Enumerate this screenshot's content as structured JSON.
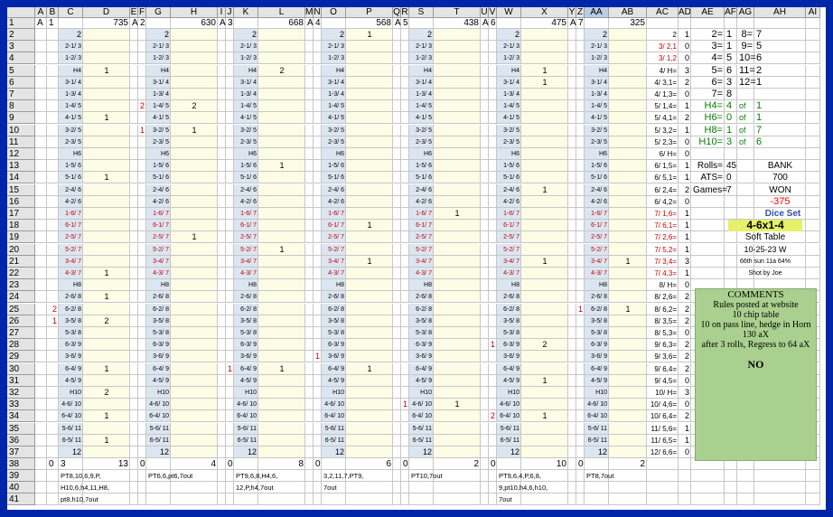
{
  "cols": [
    {
      "c": "A",
      "w": 13
    },
    {
      "c": "B",
      "w": 13
    },
    {
      "c": "C",
      "w": 27
    },
    {
      "c": "D",
      "w": 52
    },
    {
      "c": "E",
      "w": 9
    },
    {
      "c": "F",
      "w": 9
    },
    {
      "c": "G",
      "w": 27
    },
    {
      "c": "H",
      "w": 52
    },
    {
      "c": "I",
      "w": 9
    },
    {
      "c": "J",
      "w": 9
    },
    {
      "c": "K",
      "w": 27
    },
    {
      "c": "L",
      "w": 52
    },
    {
      "c": "M",
      "w": 9
    },
    {
      "c": "N",
      "w": 9
    },
    {
      "c": "O",
      "w": 27
    },
    {
      "c": "P",
      "w": 52
    },
    {
      "c": "Q",
      "w": 9
    },
    {
      "c": "R",
      "w": 9
    },
    {
      "c": "S",
      "w": 27
    },
    {
      "c": "T",
      "w": 52
    },
    {
      "c": "U",
      "w": 9
    },
    {
      "c": "V",
      "w": 9
    },
    {
      "c": "W",
      "w": 27
    },
    {
      "c": "X",
      "w": 52
    },
    {
      "c": "Y",
      "w": 9
    },
    {
      "c": "Z",
      "w": 9
    },
    {
      "c": "AA",
      "w": 27
    },
    {
      "c": "AB",
      "w": 42
    },
    {
      "c": "AC",
      "w": 35
    },
    {
      "c": "AD",
      "w": 14
    },
    {
      "c": "AE",
      "w": 37
    },
    {
      "c": "AF",
      "w": 14
    },
    {
      "c": "AG",
      "w": 19
    },
    {
      "c": "AH",
      "w": 57
    },
    {
      "c": "AI",
      "w": 16
    }
  ],
  "rows": [
    "1",
    "2",
    "3",
    "4",
    "5",
    "6",
    "7",
    "8",
    "9",
    "10",
    "11",
    "12",
    "13",
    "14",
    "15",
    "16",
    "17",
    "18",
    "19",
    "20",
    "21",
    "22",
    "23",
    "24",
    "25",
    "26",
    "27",
    "28",
    "29",
    "30",
    "31",
    "32",
    "33",
    "34",
    "35",
    "36",
    "37",
    "38",
    "39",
    "40",
    "41"
  ],
  "point_labels": [
    "2",
    "2-1/ 3",
    "1-2/ 3",
    "H4",
    "3-1/ 4",
    "1-3/ 4",
    "1-4/ 5",
    "4-1/ 5",
    "3-2/ 5",
    "2-3/ 5",
    "H6",
    "1-5/ 6",
    "5-1/ 6",
    "2-4/ 6",
    "4-2/ 6",
    "1-6/ 7",
    "6-1/ 7",
    "2-5/ 7",
    "5-2/ 7",
    "3-4/ 7",
    "4-3/ 7",
    "H8",
    "2-6/ 8",
    "6-2/ 8",
    "3-5/ 8",
    "5-3/ 8",
    "6-3/ 9",
    "3-6/ 9",
    "6-4/ 9",
    "4-5/ 9",
    "H10",
    "4-6/ 10",
    "6-4/ 10",
    "5-6/ 11",
    "6-5/ 11",
    "12"
  ],
  "row1": {
    "A": "A",
    "B": "1",
    "D": "735",
    "E": "A",
    "F": "2",
    "H": "630",
    "I": "A",
    "J": "3",
    "L": "668",
    "M": "A",
    "N": "4",
    "P": "568",
    "Q": "A",
    "R": "5",
    "T": "438",
    "U": "A",
    "V": "6",
    "X": "475",
    "Y": "A",
    "Z": "7",
    "AB": "325"
  },
  "blocks": [
    {
      "lc": "C",
      "vc": "D",
      "sc": "B",
      "pc": "E",
      "marks": {
        "5": "1",
        "9": "1",
        "14": "1",
        "22": "1",
        "24": "1",
        "26": "2",
        "30": "1",
        "32": "2",
        "34": "1",
        "36": "1"
      },
      "side": {
        "25": "2",
        "26": "1"
      },
      "total": "13",
      "start": "0",
      "count": "3",
      "notes": [
        "PT8,10,6,9,P,",
        "H10,6,h4,11,H8,",
        "pt8,h10,7out"
      ]
    },
    {
      "lc": "G",
      "vc": "H",
      "sc": "F",
      "pc": "I",
      "marks": {
        "8": "2",
        "10": "1",
        "19": "1"
      },
      "side": {
        "8": "2",
        "10": "1"
      },
      "total": "4",
      "start": "0",
      "count": "",
      "notes": [
        "PT6,6,pt6,7out"
      ]
    },
    {
      "lc": "K",
      "vc": "L",
      "sc": "J",
      "pc": "M",
      "marks": {
        "5": "2",
        "13": "1",
        "20": "1",
        "30": "1"
      },
      "side": {
        "30": "1"
      },
      "total": "8",
      "start": "0",
      "count": "",
      "notes": [
        "PT9,6,8,H4,6,",
        "12,P,h4,7out"
      ]
    },
    {
      "lc": "O",
      "vc": "P",
      "sc": "N",
      "pc": "Q",
      "marks": {
        "2": "1",
        "18": "1",
        "21": "1",
        "30": "1"
      },
      "side": {
        "29": "1"
      },
      "total": "6",
      "start": "0",
      "count": "",
      "notes": [
        "3,2,11,7,PT9,",
        "7out"
      ]
    },
    {
      "lc": "S",
      "vc": "T",
      "sc": "R",
      "pc": "U",
      "marks": {
        "17": "1",
        "33": "1"
      },
      "side": {
        "33": "1"
      },
      "total": "2",
      "start": "0",
      "count": "",
      "notes": [
        "PT10,7out"
      ]
    },
    {
      "lc": "W",
      "vc": "X",
      "sc": "V",
      "pc": "Y",
      "marks": {
        "5": "1",
        "6": "1",
        "15": "1",
        "21": "1",
        "28": "2",
        "31": "1",
        "34": "1"
      },
      "side": {
        "28": "1",
        "34": "2"
      },
      "total": "10",
      "start": "0",
      "count": "",
      "notes": [
        "PT9,6,4,P,6,8,",
        "9,pt10,h4,6,h10,",
        "7out"
      ]
    },
    {
      "lc": "AA",
      "vc": "AB",
      "sc": "Z",
      "pc": "",
      "marks": {
        "21": "1",
        "25": "1"
      },
      "side": {
        "25": "1"
      },
      "total": "2",
      "start": "0",
      "count": "",
      "notes": [
        "PT8,7out"
      ]
    }
  ],
  "ac_col": [
    "2",
    "3/ 2,1",
    "3/ 1,2",
    "4/ H=",
    "4/ 3,1=",
    "4/ 1,3=",
    "5/ 1,4=",
    "5/ 4,1=",
    "5/ 3,2=",
    "5/ 2,3=",
    "6/ H=",
    "6/ 1,5=",
    "6/ 5,1=",
    "6/ 2,4=",
    "6/ 4,2=",
    "7/ 1,6=",
    "7/ 6,1=",
    "7/ 2,6=",
    "7/ 5,2=",
    "7/ 3,4=",
    "7/ 4,3=",
    "8/ H=",
    "8/ 2,6=",
    "8/ 6,2=",
    "8/ 3,5=",
    "8/ 5,3=",
    "9/ 6,3=",
    "9/ 3,6=",
    "9/ 6,4=",
    "9/ 4,5=",
    "10/ H=",
    "10/ 4,6=",
    "10/ 6,4=",
    "11/ 5,6=",
    "11/ 6,5=",
    "12/ 6,6="
  ],
  "ad_col": {
    "2": "1",
    "3": "0",
    "4": "0",
    "5": "3",
    "6": "2",
    "7": "0",
    "8": "1",
    "9": "2",
    "10": "1",
    "11": "0",
    "12": "0",
    "13": "1",
    "14": "1",
    "15": "2",
    "16": "0",
    "17": "1",
    "18": "1",
    "19": "1",
    "20": "1",
    "21": "3",
    "22": "1",
    "23": "0",
    "24": "2",
    "25": "2",
    "26": "2",
    "27": "0",
    "28": "2",
    "29": "2",
    "30": "2",
    "31": "0",
    "32": "3",
    "33": "0",
    "34": "2",
    "35": "1",
    "36": "1",
    "37": "0"
  },
  "summary": {
    "r2": {
      "AE": "2=",
      "AF": "1",
      "AG": "8=",
      "AH": "7"
    },
    "r3": {
      "AE": "3=",
      "AF": "1",
      "AG": "9=",
      "AH": "5"
    },
    "r4": {
      "AE": "4=",
      "AF": "5",
      "AG": "10=",
      "AH": "6"
    },
    "r5": {
      "AE": "5=",
      "AF": "6",
      "AG": "11=",
      "AH": "2"
    },
    "r6": {
      "AE": "6=",
      "AF": "3",
      "AG": "12=",
      "AH": "1"
    },
    "r7": {
      "AE": "7=",
      "AF": "8"
    },
    "hard": [
      {
        "r": "8",
        "lbl": "H4=",
        "v": "4",
        "of": "of",
        "n": "1"
      },
      {
        "r": "9",
        "lbl": "H6=",
        "v": "0",
        "of": "of",
        "n": "1"
      },
      {
        "r": "10",
        "lbl": "H8=",
        "v": "1",
        "of": "of",
        "n": "7"
      },
      {
        "r": "11",
        "lbl": "H10=",
        "v": "3",
        "of": "of",
        "n": "6"
      }
    ],
    "rolls_label": "Rolls=",
    "rolls": "45",
    "ats_label": "ATS=",
    "ats": "0",
    "games_label": "Games=",
    "games": "7",
    "bank_label": "BANK",
    "bank": "700",
    "won_label": "WON",
    "won": "-375",
    "dice_set_label": "Dice Set",
    "dice_set": "4-6x1-4",
    "table": "Soft Table",
    "date": "10-25-23 W",
    "session": "66th sun 11a 64%",
    "shot_by": "Shot by Joe"
  },
  "comments": {
    "title": "COMMENTS",
    "lines": [
      "Rules posted at website",
      "10 chip table",
      "10 on pass line, hedge in Horn",
      "130 aX",
      "after 3 rolls, Regress to 64 aX"
    ],
    "final": "NO"
  },
  "colors": {
    "frame": "#0026a8",
    "header_bg": "#e4e4e4",
    "label_blue": "#dce6f1",
    "value_yellow": "#fdfde6",
    "selected_bg": "#b8cce4",
    "green": "#007f00",
    "red": "#ff0000",
    "seven_red": "#c00000",
    "dice_set_bg": "#e6f06a",
    "comments_bg": "#a9d08e"
  }
}
